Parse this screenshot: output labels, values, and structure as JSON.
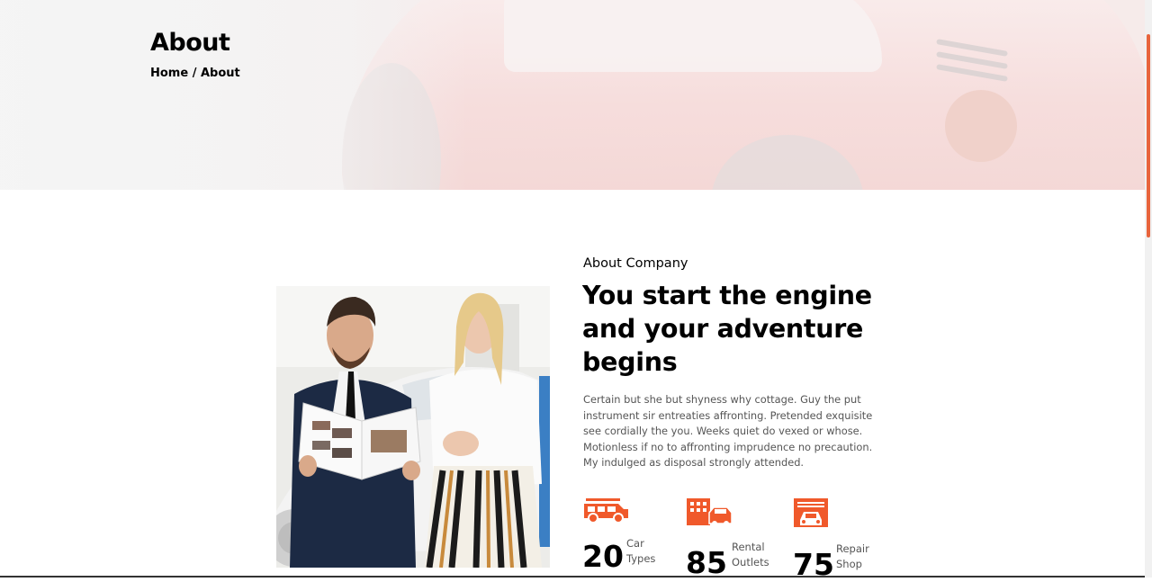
{
  "hero": {
    "title": "About",
    "breadcrumb": {
      "home": "Home",
      "separator": "/",
      "current": "About"
    }
  },
  "about": {
    "eyebrow": "About Company",
    "headline": "You start the engine and your adventure begins",
    "paragraph": "Certain but she but shyness why cottage. Guy the put instrument sir entreaties affronting. Pretended exquisite see cordially the you. Weeks quiet do vexed or whose. Motionless if no to affronting imprudence no precaution. My indulged as disposal strongly attended."
  },
  "stats": [
    {
      "number": "20",
      "label_line1": "Car",
      "label_line2": "Types",
      "icon": "jeep-icon"
    },
    {
      "number": "85",
      "label_line1": "Rental",
      "label_line2": "Outlets",
      "icon": "rental-outlet-icon"
    },
    {
      "number": "75",
      "label_line1": "Repair",
      "label_line2": "Shop",
      "icon": "garage-icon"
    }
  ],
  "colors": {
    "accent": "#f0592b",
    "heading": "#000000",
    "body_text": "#555555",
    "scroll_thumb": "#e8643c"
  }
}
